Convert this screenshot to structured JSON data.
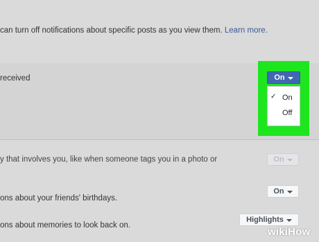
{
  "hint": {
    "text": "can turn off notifications about specific posts as you view them.",
    "link": "Learn more."
  },
  "rows": [
    {
      "text": "received"
    },
    {
      "text": "y that involves you, like when someone tags you in a photo or"
    },
    {
      "text": "ons about your friends' birthdays."
    },
    {
      "text": "ons about memories to look back on."
    }
  ],
  "dropdown_main": {
    "label": "On"
  },
  "menu": {
    "items": [
      {
        "label": "On",
        "checked": "✓"
      },
      {
        "label": "Off",
        "checked": ""
      }
    ]
  },
  "buttons": {
    "tags_disabled": "On",
    "birthdays": "On",
    "memories": "Highlights"
  },
  "watermark": {
    "wiki": "wiki",
    "how": "How"
  }
}
